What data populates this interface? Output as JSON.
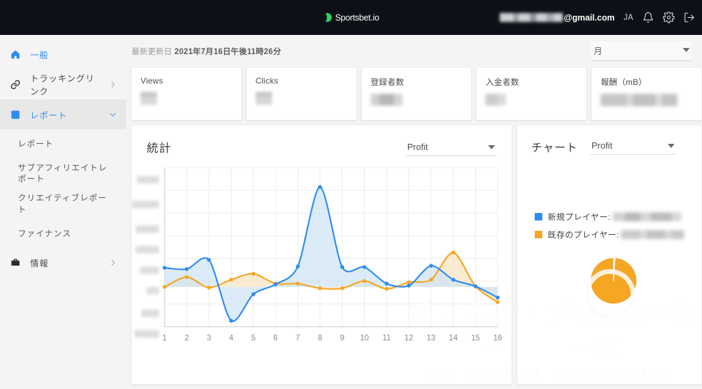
{
  "topbar": {
    "brand": "Sportsbet.io",
    "brand_mark_icon": "sportsbet-logo-icon",
    "email_domain": "@gmail.com",
    "email_user_masked": "",
    "lang": "JA",
    "bell_icon": "bell-icon",
    "gear_icon": "gear-icon",
    "logout_icon": "logout-icon",
    "bg": "#0d1117"
  },
  "sidebar": {
    "items": [
      {
        "label": "一般",
        "icon": "home-icon",
        "active_color": true,
        "chevron": false
      },
      {
        "label": "トラッキングリンク",
        "icon": "link-icon",
        "active_color": false,
        "chevron": true
      },
      {
        "label": "レポート",
        "icon": "report-icon",
        "active_color": true,
        "chevron": false,
        "expanded": true
      }
    ],
    "subitems": [
      {
        "label": "レポート"
      },
      {
        "label": "サブアフィリエイトレポート"
      },
      {
        "label": "クリエイティブレポート"
      },
      {
        "label": "ファイナンス"
      }
    ],
    "footer_item": {
      "label": "情報",
      "icon": "briefcase-icon",
      "chevron": true
    }
  },
  "main": {
    "updated_prefix": "最新更新日",
    "updated_value": "2021年7月16日午後11時26分",
    "period": {
      "value": "月",
      "caret_icon": "chevron-down-icon"
    }
  },
  "cards": [
    {
      "title": "Views",
      "value_masked": "",
      "blur": "v-blur-1"
    },
    {
      "title": "Clicks",
      "value_masked": "",
      "blur": "v-blur-1"
    },
    {
      "title": "登録者数",
      "value_masked": "",
      "blur": "v-blur-2"
    },
    {
      "title": "入金者数",
      "value_masked": "",
      "blur": "v-blur-3"
    },
    {
      "title": "報酬（mB）",
      "value_masked": "",
      "blur": "v-blur-4"
    }
  ],
  "stats_panel": {
    "title": "統計",
    "metric": "Profit",
    "caret_icon": "chevron-down-icon"
  },
  "chart_panel": {
    "title": "チャート",
    "metric": "Profit",
    "caret_icon": "chevron-down-icon",
    "legend": [
      {
        "label": "新規プレイヤー:",
        "color": "#2d8cf0",
        "value_masked": ""
      },
      {
        "label": "既存のプレイヤー:",
        "color": "#f5a623",
        "value_masked": ""
      }
    ]
  },
  "watermark": {
    "jp": "ザ・ブックメーカーズ",
    "en": "THE BOOKMAKERS"
  },
  "chart_data": [
    {
      "id": "statistics-line-chart",
      "type": "line",
      "title": "統計",
      "metric": "Profit",
      "xlabel": "",
      "ylabel": "",
      "grid": true,
      "legend_position": "none",
      "x": [
        1,
        2,
        3,
        4,
        5,
        6,
        7,
        8,
        9,
        10,
        11,
        12,
        13,
        14,
        15,
        16
      ],
      "xticklabels": [
        "1",
        "2",
        "3",
        "4",
        "5",
        "6",
        "7",
        "8",
        "9",
        "10",
        "11",
        "12",
        "13",
        "14",
        "15",
        "16"
      ],
      "yticklabels": [
        "",
        "",
        "",
        "",
        "",
        "",
        "",
        ""
      ],
      "ylim": [
        -3,
        9
      ],
      "baseline": 0,
      "series": [
        {
          "name": "新規プレイヤー",
          "color": "#2d8cf0",
          "fill": "#cfe3f5",
          "values": [
            1.45,
            1.35,
            2.05,
            -2.55,
            -0.55,
            0.2,
            1.55,
            7.55,
            1.5,
            1.5,
            0.25,
            0.1,
            1.6,
            0.55,
            0.05,
            -0.8
          ]
        },
        {
          "name": "既存のプレイヤー",
          "color": "#f5a623",
          "fill": "#fbe3c2",
          "values": [
            0.0,
            0.75,
            -0.05,
            0.55,
            1.0,
            0.25,
            0.25,
            -0.1,
            -0.1,
            0.45,
            -0.15,
            0.35,
            0.55,
            2.6,
            0.05,
            -1.15
          ]
        }
      ]
    },
    {
      "id": "players-donut-chart",
      "type": "pie",
      "title": "チャート",
      "metric": "Profit",
      "labels": [
        "新規プレイヤー",
        "既存のプレイヤー"
      ],
      "colors": [
        "#2d8cf0",
        "#f5a623"
      ],
      "values": [
        1,
        99
      ],
      "legend_position": "top"
    }
  ]
}
